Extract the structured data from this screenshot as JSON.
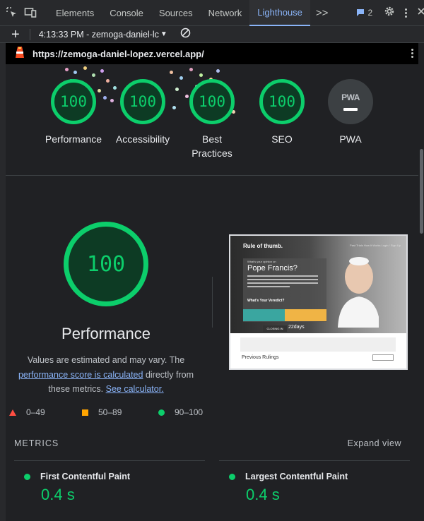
{
  "devtools": {
    "tabs": [
      "Elements",
      "Console",
      "Sources",
      "Network",
      "Lighthouse"
    ],
    "active_tab": "Lighthouse",
    "more_tabs": ">>",
    "issues_count": "2"
  },
  "toolbar": {
    "report_label": "4:13:33 PM - zemoga-daniel-lc"
  },
  "url": "https://zemoga-daniel-lopez.vercel.app/",
  "scores": [
    {
      "label": "Performance",
      "value": "100"
    },
    {
      "label": "Accessibility",
      "value": "100"
    },
    {
      "label": "Best Practices",
      "value": "100"
    },
    {
      "label": "SEO",
      "value": "100"
    }
  ],
  "pwa": {
    "label": "PWA",
    "badge": "PWA"
  },
  "performance": {
    "score": "100",
    "title": "Performance",
    "desc_1": "Values are estimated and may vary. The",
    "desc_link": "performance score is calculated",
    "desc_2": "directly from these metrics.",
    "desc_link_2": "See calculator."
  },
  "screenshot": {
    "brand": "Rule of thumb.",
    "nav_links": "Past Trials   How It Works   Login / Sign Up",
    "question": "What's your opinion on",
    "name": "Pope Francis?",
    "verdict": "What's Your Veredict?",
    "closing": "CLOSING IN",
    "days": "22days",
    "previous": "Previous Rulings"
  },
  "legend": [
    {
      "range": "0–49",
      "color": "#ff4e42"
    },
    {
      "range": "50–89",
      "color": "#ffa400"
    },
    {
      "range": "90–100",
      "color": "#0cce6b"
    }
  ],
  "metrics": {
    "heading": "METRICS",
    "expand": "Expand view",
    "items": [
      {
        "name": "First Contentful Paint",
        "value": "0.4 s"
      },
      {
        "name": "Largest Contentful Paint",
        "value": "0.4 s"
      }
    ]
  },
  "colors": {
    "pass": "#0cce6b",
    "link": "#8ab4f8",
    "accent": "#8ab4f8"
  }
}
